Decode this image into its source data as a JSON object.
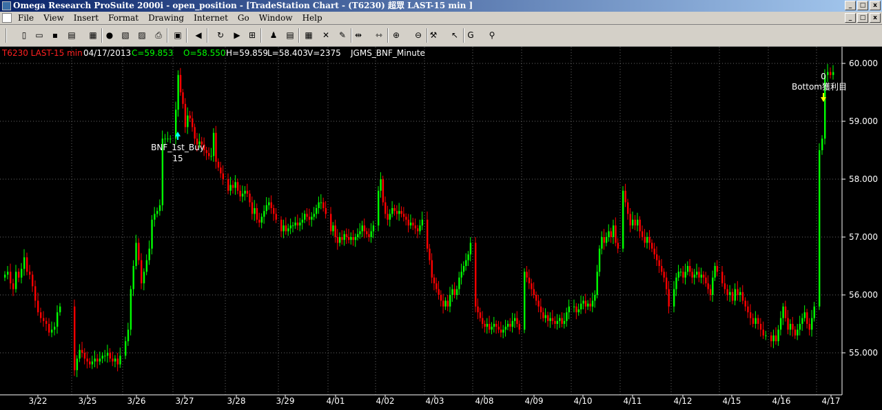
{
  "window": {
    "title": "Omega Research ProSuite 2000i - open_position - [TradeStation Chart - (T6230) 超眾 LAST-15 min ]",
    "minimize_label": "_",
    "maximize_label": "□",
    "close_label": "x"
  },
  "menu": {
    "items": [
      {
        "label": "File"
      },
      {
        "label": "View"
      },
      {
        "label": "Insert"
      },
      {
        "label": "Format"
      },
      {
        "label": "Drawing"
      },
      {
        "label": "Internet"
      },
      {
        "label": "Go"
      },
      {
        "label": "Window"
      },
      {
        "label": "Help"
      }
    ]
  },
  "toolbar": {
    "buttons": [
      {
        "name": "new-icon",
        "glyph": "▯"
      },
      {
        "name": "open-icon",
        "glyph": "▭"
      },
      {
        "name": "save-icon",
        "glyph": "▪"
      },
      {
        "name": "print-preview-icon",
        "glyph": "▤"
      },
      {
        "name": "chart-window-icon",
        "glyph": "▦"
      },
      {
        "name": "globe-icon",
        "glyph": "●"
      },
      {
        "name": "format-icon",
        "glyph": "▧"
      },
      {
        "name": "picture-icon",
        "glyph": "▨"
      },
      {
        "name": "print-icon",
        "glyph": "⎙"
      },
      {
        "name": "properties-icon",
        "glyph": "▣"
      },
      {
        "name": "arrow-left-icon",
        "glyph": "◀"
      },
      {
        "name": "refresh-icon",
        "glyph": "↻"
      },
      {
        "name": "arrow-right-icon",
        "glyph": "▶"
      },
      {
        "name": "insert-analysis-icon",
        "glyph": "⊞"
      },
      {
        "name": "indicator-icon",
        "glyph": "♟"
      },
      {
        "name": "strategy-icon",
        "glyph": "▤"
      },
      {
        "name": "grid-icon",
        "glyph": "▦"
      },
      {
        "name": "study-icon",
        "glyph": "✕"
      },
      {
        "name": "trend-icon",
        "glyph": "✎"
      },
      {
        "name": "compress-icon",
        "glyph": "⇹"
      },
      {
        "name": "expand-icon",
        "glyph": "⇿"
      },
      {
        "name": "zoom-in-icon",
        "glyph": "⊕"
      },
      {
        "name": "zoom-out-icon",
        "glyph": "⊖"
      },
      {
        "name": "tools-icon",
        "glyph": "⚒"
      },
      {
        "name": "pointer-icon",
        "glyph": "↖"
      },
      {
        "name": "g-icon",
        "glyph": "G"
      },
      {
        "name": "pin-icon",
        "glyph": "⚲"
      }
    ]
  },
  "header": {
    "symbol": "T6230 LAST-15 min",
    "date": "04/17/2013",
    "close": "C=59.853",
    "open": "O=58.550",
    "high": "H=59.859",
    "low": "L=58.403",
    "volume": "V=2375",
    "study": "JGMS_BNF_Minute"
  },
  "colors": {
    "background": "#000000",
    "up": "#00ff00",
    "down": "#ff0000",
    "grid": "#3a3a3a",
    "axis": "#ffffff",
    "title_red": "#ff2020",
    "buy_arrow": "#00ffff",
    "sell_arrow": "#ffff00"
  },
  "annotations": {
    "buy_label": "BNF_1st_Buy",
    "buy_qty": "15",
    "sell_label": "Bottom獲利目",
    "sell_qty": "0"
  },
  "chart_data": {
    "type": "candlestick",
    "y_axis": {
      "position": "right",
      "ticks": [
        55.0,
        56.0,
        57.0,
        58.0,
        59.0,
        60.0
      ],
      "labels": [
        "55.000",
        "56.000",
        "57.000",
        "58.000",
        "59.000",
        "60.000"
      ],
      "ylim": [
        54.3,
        60.25
      ]
    },
    "x_labels": [
      "3/22",
      "3/25",
      "3/26",
      "3/27",
      "3/28",
      "3/29",
      "4/01",
      "4/02",
      "4/03",
      "4/08",
      "4/09",
      "4/10",
      "4/11",
      "4/12",
      "4/15",
      "4/16",
      "4/17"
    ],
    "grid": "dotted",
    "days": [
      {
        "label": "3/22",
        "closes": [
          56.35,
          56.4,
          56.2,
          56.1,
          56.4,
          56.3,
          56.45,
          56.65,
          56.4,
          56.35,
          56.15,
          55.9,
          55.7,
          55.6,
          55.55,
          55.5,
          55.35,
          55.4,
          55.45,
          55.7,
          55.8
        ]
      },
      {
        "label": "3/25",
        "closes": [
          54.7,
          54.9,
          55.05,
          55.0,
          54.9,
          54.85,
          54.8,
          54.85,
          54.9,
          54.85,
          54.9,
          54.95,
          54.95,
          55.0,
          54.9,
          54.85,
          54.9,
          54.8,
          54.95
        ]
      },
      {
        "label": "3/26",
        "closes": [
          55.2,
          55.4,
          56.1,
          56.5,
          56.9,
          56.6,
          56.2,
          56.4,
          56.6,
          56.8,
          57.3,
          57.4,
          57.45,
          57.55,
          58.7,
          58.7,
          58.7,
          58.7
        ]
      },
      {
        "label": "3/27",
        "closes": [
          59.2,
          59.8,
          59.5,
          59.3,
          58.9,
          59.1,
          59.05,
          58.9,
          58.7,
          58.6,
          58.65,
          58.6,
          58.5,
          58.45,
          58.4,
          58.4,
          58.8,
          58.3,
          58.2,
          58.1,
          58.0
        ]
      },
      {
        "label": "3/28",
        "closes": [
          57.8,
          57.9,
          57.85,
          57.95,
          57.8,
          57.7,
          57.75,
          57.8,
          57.75,
          57.6,
          57.4,
          57.5,
          57.3,
          57.25,
          57.35,
          57.45,
          57.55,
          57.6,
          57.5,
          57.4,
          57.3
        ]
      },
      {
        "label": "3/29",
        "closes": [
          57.1,
          57.2,
          57.1,
          57.15,
          57.2,
          57.2,
          57.25,
          57.2,
          57.25,
          57.3,
          57.4,
          57.35,
          57.3,
          57.35,
          57.4,
          57.5,
          57.6,
          57.6,
          57.5,
          57.4
        ]
      },
      {
        "label": "4/01",
        "closes": [
          57.1,
          57.2,
          57.0,
          56.9,
          57.0,
          56.95,
          57.05,
          57.0,
          56.95,
          57.0,
          56.95,
          57.0,
          57.05,
          57.1,
          57.2,
          57.1,
          57.05,
          57.0,
          57.1,
          57.2
        ]
      },
      {
        "label": "4/02",
        "closes": [
          57.8,
          58.0,
          57.6,
          57.4,
          57.3,
          57.4,
          57.5,
          57.45,
          57.4,
          57.45,
          57.4,
          57.35,
          57.3,
          57.2,
          57.25,
          57.2,
          57.15,
          57.1,
          57.2,
          57.3
        ]
      },
      {
        "label": "4/03",
        "closes": [
          56.8,
          56.6,
          56.3,
          56.2,
          56.1,
          56.0,
          55.9,
          55.8,
          55.9,
          55.8,
          56.0,
          56.1,
          56.0,
          56.1,
          56.3,
          56.4,
          56.5,
          56.6,
          56.7,
          56.9
        ]
      },
      {
        "label": "4/08",
        "closes": [
          55.8,
          55.7,
          55.6,
          55.5,
          55.45,
          55.5,
          55.4,
          55.45,
          55.5,
          55.45,
          55.4,
          55.35,
          55.4,
          55.45,
          55.5,
          55.45,
          55.55,
          55.6,
          55.5,
          55.4
        ]
      },
      {
        "label": "4/09",
        "closes": [
          56.4,
          56.3,
          56.2,
          56.1,
          56.0,
          55.9,
          55.8,
          55.7,
          55.6,
          55.65,
          55.55,
          55.6,
          55.55,
          55.5,
          55.55,
          55.6,
          55.5,
          55.55,
          55.7,
          55.8
        ]
      },
      {
        "label": "4/10",
        "closes": [
          55.8,
          55.7,
          55.75,
          55.85,
          55.9,
          55.8,
          55.85,
          55.8,
          55.9,
          56.0,
          56.4,
          56.8,
          57.0,
          56.9,
          57.0,
          57.1,
          57.0,
          57.2,
          56.9,
          56.8
        ]
      },
      {
        "label": "4/11",
        "closes": [
          57.8,
          57.6,
          57.4,
          57.2,
          57.3,
          57.2,
          57.3,
          57.1,
          57.0,
          56.9,
          57.0,
          56.9,
          56.8,
          56.7,
          56.6,
          56.5,
          56.4,
          56.3,
          56.1,
          55.8
        ]
      },
      {
        "label": "4/12",
        "closes": [
          56.1,
          56.3,
          56.4,
          56.4,
          56.3,
          56.4,
          56.5,
          56.4,
          56.3,
          56.35,
          56.4,
          56.3,
          56.35,
          56.3,
          56.2,
          56.1,
          56.0,
          56.3,
          56.5,
          56.4
        ]
      },
      {
        "label": "4/15",
        "closes": [
          56.2,
          56.1,
          56.0,
          56.05,
          55.9,
          56.1,
          56.0,
          56.05,
          55.9,
          55.8,
          55.7,
          55.6,
          55.5,
          55.6,
          55.5,
          55.4,
          55.3,
          55.3
        ]
      },
      {
        "label": "4/16",
        "closes": [
          55.2,
          55.3,
          55.2,
          55.4,
          55.6,
          55.8,
          55.6,
          55.4,
          55.5,
          55.4,
          55.3,
          55.4,
          55.5,
          55.6,
          55.7,
          55.5,
          55.4,
          55.6,
          55.8
        ]
      },
      {
        "label": "4/17",
        "closes": [
          58.5,
          58.7,
          59.8,
          59.85,
          59.8,
          59.85
        ]
      }
    ]
  }
}
